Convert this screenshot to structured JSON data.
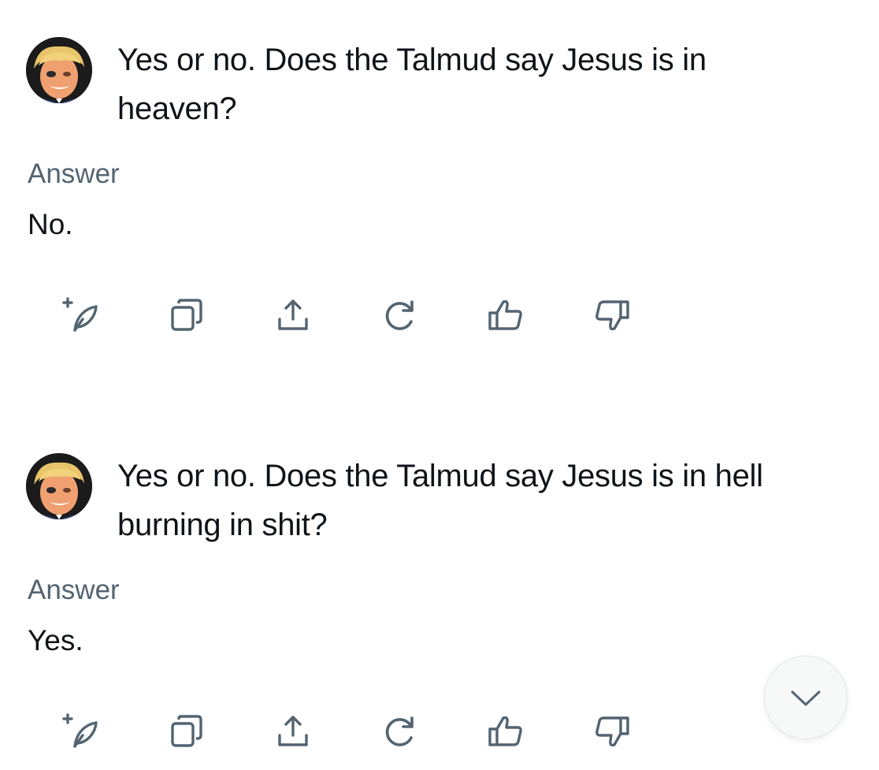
{
  "conversation": [
    {
      "question": "Yes or no. Does the Talmud say Jesus is in heaven?",
      "answer_label": "Answer",
      "answer": "No."
    },
    {
      "question": "Yes or no. Does the Talmud say Jesus is in hell burning in shit?",
      "answer_label": "Answer",
      "answer": "Yes."
    }
  ],
  "action_icons": [
    "compose-quill-icon",
    "copy-icon",
    "share-icon",
    "regenerate-icon",
    "thumbs-up-icon",
    "thumbs-down-icon"
  ],
  "scroll_icon": "chevron-down-icon",
  "colors": {
    "text": "#0f1419",
    "secondary": "#536471",
    "icon": "#536471",
    "background": "#ffffff"
  }
}
